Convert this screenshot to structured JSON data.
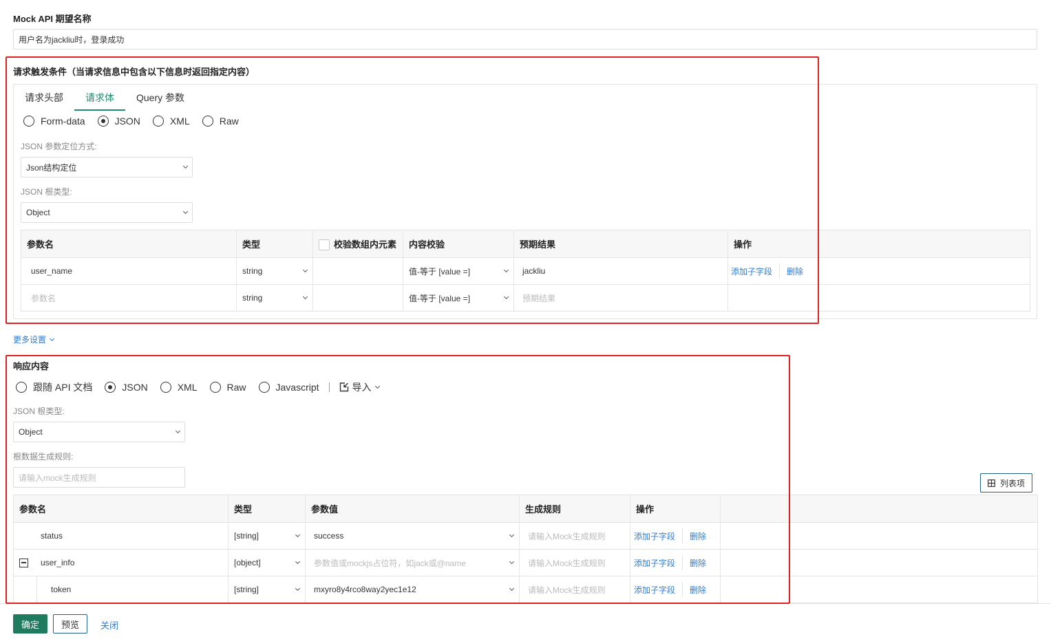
{
  "mock_name": {
    "label": "Mock API 期望名称",
    "value": "用户名为jackliu时，登录成功"
  },
  "request_trigger": {
    "title": "请求触发条件（当请求信息中包含以下信息时返回指定内容）",
    "tabs": [
      {
        "label": "请求头部",
        "active": false
      },
      {
        "label": "请求体",
        "active": true
      },
      {
        "label": "Query 参数",
        "active": false
      }
    ],
    "body_types": [
      {
        "label": "Form-data",
        "selected": false
      },
      {
        "label": "JSON",
        "selected": true
      },
      {
        "label": "XML",
        "selected": false
      },
      {
        "label": "Raw",
        "selected": false
      }
    ],
    "locate_label": "JSON 参数定位方式:",
    "locate_value": "Json结构定位",
    "root_type_label": "JSON 根类型:",
    "root_type_value": "Object",
    "table": {
      "headers": {
        "name": "参数名",
        "type": "类型",
        "check_array": "校验数组内元素",
        "content_check": "内容校验",
        "expected": "预期结果",
        "ops": "操作"
      },
      "rows": [
        {
          "name": "user_name",
          "type": "string",
          "check": "值-等于 [value =]",
          "expected": "jackliu",
          "add_child": "添加子字段",
          "delete": "删除"
        },
        {
          "name_placeholder": "参数名",
          "type": "string",
          "check": "值-等于 [value =]",
          "expected_placeholder": "预期结果"
        }
      ]
    }
  },
  "more_settings": "更多设置",
  "response": {
    "title": "响应内容",
    "types": [
      {
        "label": "跟随 API 文档",
        "selected": false
      },
      {
        "label": "JSON",
        "selected": true
      },
      {
        "label": "XML",
        "selected": false
      },
      {
        "label": "Raw",
        "selected": false
      },
      {
        "label": "Javascript",
        "selected": false
      }
    ],
    "import_label": "导入",
    "root_type_label": "JSON 根类型:",
    "root_type_value": "Object",
    "root_rule_label": "根数据生成规则:",
    "root_rule_placeholder": "请输入mock生成规则",
    "columns_button": "列表项",
    "table": {
      "headers": {
        "name": "参数名",
        "type": "类型",
        "value": "参数值",
        "rule": "生成规则",
        "ops": "操作"
      },
      "rows": [
        {
          "name": "status",
          "type": "[string]",
          "value": "success",
          "rule_placeholder": "请输入Mock生成规则",
          "add_child": "添加子字段",
          "delete": "删除"
        },
        {
          "name": "user_info",
          "type": "[object]",
          "value_placeholder": "参数值或mockjs占位符，如jack或@name",
          "rule_placeholder": "请输入Mock生成规则",
          "add_child": "添加子字段",
          "delete": "删除"
        },
        {
          "name": "token",
          "type": "[string]",
          "value": "mxyro8y4rco8way2yec1e12",
          "rule_placeholder": "请输入Mock生成规则",
          "add_child": "添加子字段",
          "delete": "删除"
        }
      ]
    }
  },
  "footer": {
    "confirm": "确定",
    "preview": "预览",
    "close": "关闭"
  },
  "colors": {
    "primary": "#1f7a5e",
    "tab_active": "#1f8a6e",
    "link": "#2f7bd0",
    "highlight": "#e0201f"
  }
}
